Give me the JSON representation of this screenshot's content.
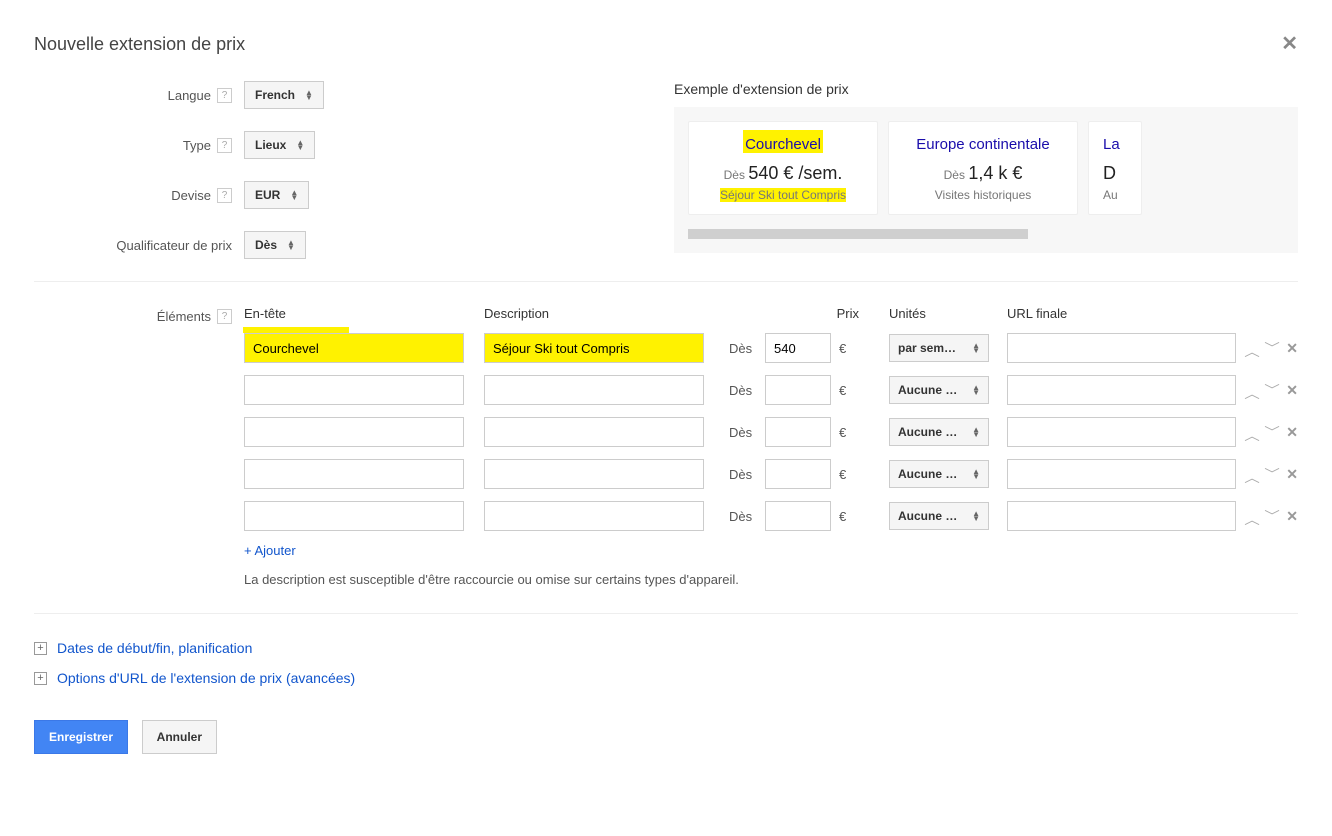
{
  "dialog": {
    "title": "Nouvelle extension de prix"
  },
  "form": {
    "langue_label": "Langue",
    "langue_value": "French",
    "type_label": "Type",
    "type_value": "Lieux",
    "devise_label": "Devise",
    "devise_value": "EUR",
    "qualificateur_label": "Qualificateur de prix",
    "qualificateur_value": "Dès"
  },
  "preview": {
    "title": "Exemple d'extension de prix",
    "cards": [
      {
        "header": "Courchevel",
        "qualifier": "Dès",
        "price": "540 € /sem.",
        "desc": "Séjour Ski tout Compris",
        "highlight": true
      },
      {
        "header": "Europe continentale",
        "qualifier": "Dès",
        "price": "1,4 k €",
        "desc": "Visites historiques",
        "highlight": false
      },
      {
        "header": "La",
        "qualifier": "",
        "price": "D",
        "desc": "Au",
        "highlight": false,
        "cut": true
      }
    ]
  },
  "elements": {
    "label": "Éléments",
    "columns": {
      "header": "En-tête",
      "description": "Description",
      "prix": "Prix",
      "unites": "Unités",
      "url": "URL finale"
    },
    "currency": "€",
    "qualifier": "Dès",
    "rows": [
      {
        "header": "Courchevel",
        "description": "Séjour Ski tout Compris",
        "price": "540",
        "unit": "par sem…",
        "url": "",
        "hl": true
      },
      {
        "header": "",
        "description": "",
        "price": "",
        "unit": "Aucune …",
        "url": "",
        "hl": false
      },
      {
        "header": "",
        "description": "",
        "price": "",
        "unit": "Aucune …",
        "url": "",
        "hl": false
      },
      {
        "header": "",
        "description": "",
        "price": "",
        "unit": "Aucune …",
        "url": "",
        "hl": false
      },
      {
        "header": "",
        "description": "",
        "price": "",
        "unit": "Aucune …",
        "url": "",
        "hl": false
      }
    ],
    "add_label": "+ Ajouter",
    "hint": "La description est susceptible d'être raccourcie ou omise sur certains types d'appareil."
  },
  "expanders": {
    "dates": "Dates de début/fin, planification",
    "url_options": "Options d'URL de l'extension de prix (avancées)"
  },
  "actions": {
    "save": "Enregistrer",
    "cancel": "Annuler"
  }
}
